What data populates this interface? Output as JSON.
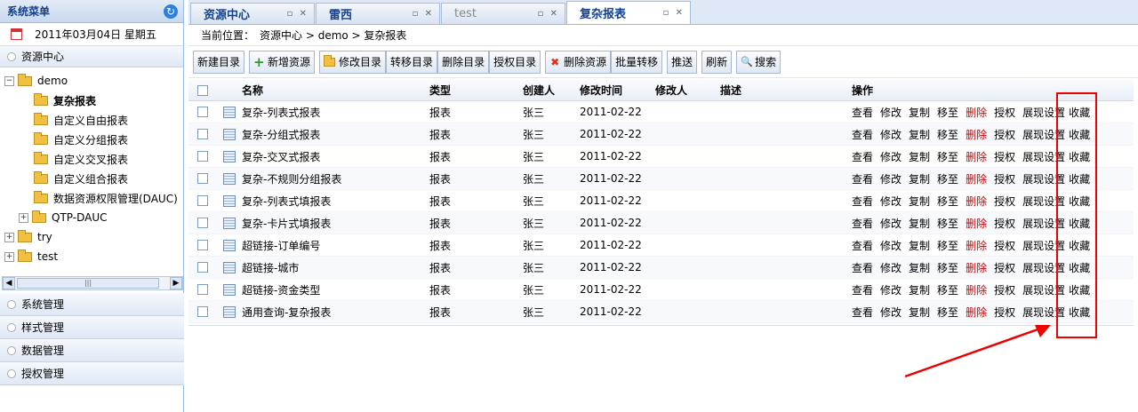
{
  "sidebar": {
    "title": "系统菜单",
    "date": "2011年03月04日  星期五",
    "sections_top": [
      "资源中心"
    ],
    "tree": [
      {
        "label": "demo",
        "level": 0,
        "toggle": "−",
        "folder": true
      },
      {
        "label": "复杂报表",
        "level": 1,
        "folder": true,
        "bold": true
      },
      {
        "label": "自定义自由报表",
        "level": 1,
        "folder": true
      },
      {
        "label": "自定义分组报表",
        "level": 1,
        "folder": true
      },
      {
        "label": "自定义交叉报表",
        "level": 1,
        "folder": true
      },
      {
        "label": "自定义组合报表",
        "level": 1,
        "folder": true
      },
      {
        "label": "数据资源权限管理(DAUC)",
        "level": 1,
        "folder": true
      },
      {
        "label": "QTP-DAUC",
        "level": 1,
        "toggle": "+",
        "folder": true
      },
      {
        "label": "try",
        "level": 0,
        "toggle": "+",
        "folder": true
      },
      {
        "label": "test",
        "level": 0,
        "toggle": "+",
        "folder": true
      }
    ],
    "sections_bottom": [
      "系统管理",
      "样式管理",
      "数据管理",
      "授权管理"
    ]
  },
  "tabs": [
    {
      "label": "资源中心",
      "state": "normal"
    },
    {
      "label": "雷西",
      "state": "normal"
    },
    {
      "label": "test",
      "state": "grey"
    },
    {
      "label": "复杂报表",
      "state": "active"
    }
  ],
  "breadcrumb": {
    "label": "当前位置：",
    "path": "资源中心  > demo > 复杂报表"
  },
  "toolbar": [
    {
      "label": "新建目录",
      "icon": ""
    },
    {
      "label": "新增资源",
      "icon": "+",
      "color": "#2a9a2a",
      "gap": true
    },
    {
      "label": "修改目录",
      "icon": "folder",
      "gap": true
    },
    {
      "label": "转移目录",
      "icon": ""
    },
    {
      "label": "删除目录",
      "icon": ""
    },
    {
      "label": "授权目录",
      "icon": ""
    },
    {
      "label": "删除资源",
      "icon": "×",
      "color": "#e03020",
      "gap": true
    },
    {
      "label": "批量转移",
      "icon": ""
    },
    {
      "label": "推送",
      "icon": "",
      "gap": true
    },
    {
      "label": "刷新",
      "icon": "",
      "gap": true
    },
    {
      "label": "搜索",
      "icon": "search",
      "gap": true
    }
  ],
  "grid": {
    "headers": [
      "名称",
      "类型",
      "创建人",
      "修改时间",
      "修改人",
      "描述",
      "操作"
    ],
    "operations": [
      "查看",
      "修改",
      "复制",
      "移至",
      "删除",
      "授权",
      "展现设置",
      "收藏"
    ],
    "rows": [
      {
        "name": "复杂-列表式报表",
        "type": "报表",
        "creator": "张三",
        "modified": "2011-02-22"
      },
      {
        "name": "复杂-分组式报表",
        "type": "报表",
        "creator": "张三",
        "modified": "2011-02-22"
      },
      {
        "name": "复杂-交叉式报表",
        "type": "报表",
        "creator": "张三",
        "modified": "2011-02-22"
      },
      {
        "name": "复杂-不规则分组报表",
        "type": "报表",
        "creator": "张三",
        "modified": "2011-02-22"
      },
      {
        "name": "复杂-列表式填报表",
        "type": "报表",
        "creator": "张三",
        "modified": "2011-02-22"
      },
      {
        "name": "复杂-卡片式填报表",
        "type": "报表",
        "creator": "张三",
        "modified": "2011-02-22"
      },
      {
        "name": "超链接-订单编号",
        "type": "报表",
        "creator": "张三",
        "modified": "2011-02-22"
      },
      {
        "name": "超链接-城市",
        "type": "报表",
        "creator": "张三",
        "modified": "2011-02-22"
      },
      {
        "name": "超链接-资金类型",
        "type": "报表",
        "creator": "张三",
        "modified": "2011-02-22"
      },
      {
        "name": "通用查询-复杂报表",
        "type": "报表",
        "creator": "张三",
        "modified": "2011-02-22"
      }
    ]
  },
  "colors": {
    "delete": "#cc0000",
    "highlight": "#ee0000"
  }
}
